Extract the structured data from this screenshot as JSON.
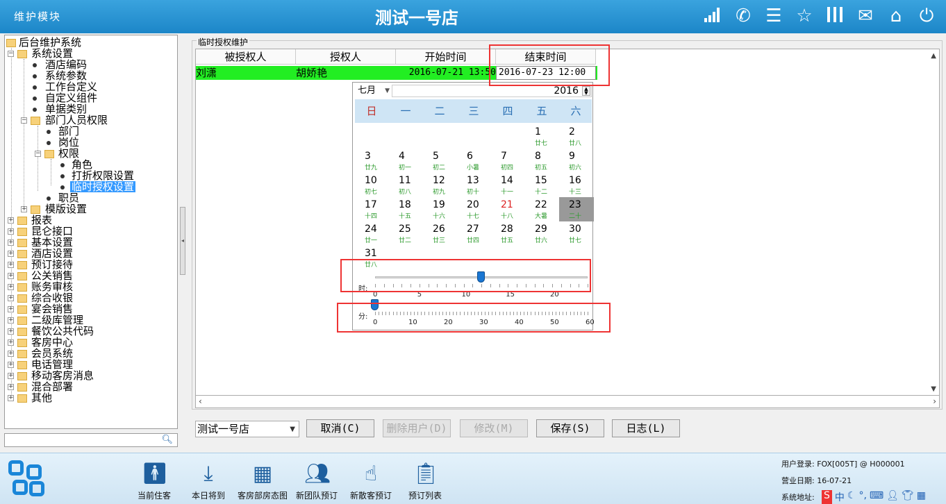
{
  "titlebar": {
    "module": "维护模块",
    "store": "测试一号店",
    "icons": [
      "signal-icon",
      "phone-icon",
      "menu-icon",
      "star-icon",
      "columns-icon",
      "mail-icon",
      "home-icon",
      "power-icon"
    ]
  },
  "tree": {
    "root": "后台维护系统",
    "sys_settings": "系统设置",
    "hotel_code": "酒店编码",
    "sys_params": "系统参数",
    "workbench": "工作台定义",
    "custom_comp": "自定义组件",
    "doc_types": "单据类别",
    "dept_perm": "部门人员权限",
    "dept": "部门",
    "post": "岗位",
    "perm": "权限",
    "role": "角色",
    "discount_perm": "打折权限设置",
    "temp_auth": "临时授权设置",
    "staff": "职员",
    "template": "模版设置",
    "others": [
      "报表",
      "昆仑接口",
      "基本设置",
      "酒店设置",
      "预订接待",
      "公关销售",
      "账务审核",
      "综合收银",
      "宴会销售",
      "二级库管理",
      "餐饮公共代码",
      "客房中心",
      "会员系统",
      "电话管理",
      "移动客房消息",
      "混合部署",
      "其他"
    ]
  },
  "panel": {
    "legend": "临时授权维护",
    "columns": [
      "被授权人",
      "授权人",
      "开始时间",
      "结束时间"
    ],
    "row": {
      "grantee": "刘潇",
      "grantor": "胡娇艳",
      "start": "2016-07-21 13:50",
      "end": "2016-07-23 12:00"
    }
  },
  "calendar": {
    "month": "七月",
    "year": "2016",
    "weekdays": [
      "日",
      "一",
      "二",
      "三",
      "四",
      "五",
      "六"
    ],
    "days": [
      {
        "n": "1",
        "l": "廿七"
      },
      {
        "n": "2",
        "l": "廿八"
      },
      {
        "n": "3",
        "l": "廿九"
      },
      {
        "n": "4",
        "l": "初一"
      },
      {
        "n": "5",
        "l": "初二"
      },
      {
        "n": "6",
        "l": "小暑"
      },
      {
        "n": "7",
        "l": "初四"
      },
      {
        "n": "8",
        "l": "初五"
      },
      {
        "n": "9",
        "l": "初六"
      },
      {
        "n": "10",
        "l": "初七"
      },
      {
        "n": "11",
        "l": "初八"
      },
      {
        "n": "12",
        "l": "初九"
      },
      {
        "n": "13",
        "l": "初十"
      },
      {
        "n": "14",
        "l": "十一"
      },
      {
        "n": "15",
        "l": "十二"
      },
      {
        "n": "16",
        "l": "十三"
      },
      {
        "n": "17",
        "l": "十四"
      },
      {
        "n": "18",
        "l": "十五"
      },
      {
        "n": "19",
        "l": "十六"
      },
      {
        "n": "20",
        "l": "十七"
      },
      {
        "n": "21",
        "l": "十八"
      },
      {
        "n": "22",
        "l": "大暑"
      },
      {
        "n": "23",
        "l": "二十"
      },
      {
        "n": "24",
        "l": "廿一"
      },
      {
        "n": "25",
        "l": "廿二"
      },
      {
        "n": "26",
        "l": "廿三"
      },
      {
        "n": "27",
        "l": "廿四"
      },
      {
        "n": "28",
        "l": "廿五"
      },
      {
        "n": "29",
        "l": "廿六"
      },
      {
        "n": "30",
        "l": "廿七"
      },
      {
        "n": "31",
        "l": "廿八"
      }
    ],
    "first_weekday": 5,
    "selected_day": "23",
    "today_day": "21",
    "hour_label": "时:",
    "hour_scale": [
      "0",
      "5",
      "10",
      "15",
      "20"
    ],
    "hour_value": 12,
    "hour_max": 23,
    "minute_label": "分:",
    "minute_scale": [
      "0",
      "10",
      "20",
      "30",
      "40",
      "50",
      "60"
    ],
    "minute_value": 0,
    "minute_max": 60
  },
  "bottom": {
    "store_select": "测试一号店",
    "cancel": "取消(C)",
    "delete_user": "删除用户(D)",
    "modify": "修改(M)",
    "save": "保存(S)",
    "log": "日志(L)"
  },
  "taskbar": {
    "items": [
      "当前住客",
      "本日将到",
      "客房部房态图",
      "新团队预订",
      "新散客预订",
      "预订列表"
    ],
    "user_login": "用户登录: FOX[005T] @ H000001",
    "biz_date": "营业日期: 16-07-21",
    "sys_addr": "系统地址:",
    "tray_ime": "中"
  }
}
